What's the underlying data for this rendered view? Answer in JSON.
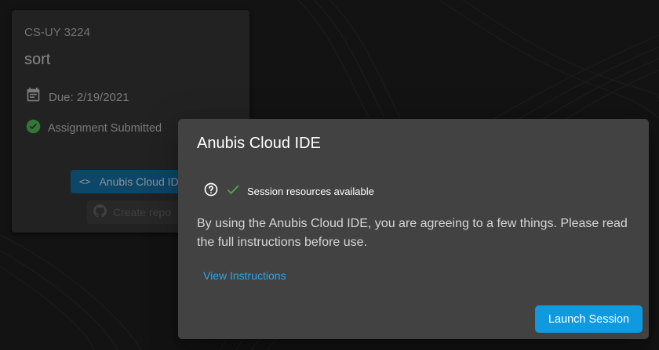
{
  "card": {
    "course": "CS-UY 3224",
    "name": "sort",
    "due": "Due: 2/19/2021",
    "status": "Assignment Submitted",
    "ide_button": "Anubis Cloud IDE",
    "ide_button_icon": "code-icon",
    "repo_button": "Create repo",
    "repo_button_icon": "github-icon"
  },
  "dialog": {
    "title": "Anubis Cloud IDE",
    "status_text": "Session resources available",
    "body": "By using the Anubis Cloud IDE, you are agreeing to a few things. Please read the full instructions before use.",
    "link": "View Instructions",
    "launch_button": "Launch Session"
  },
  "colors": {
    "accent": "#0f9ae0",
    "link": "#2aa6e6",
    "success": "#4caf50",
    "dialog_bg": "#424242",
    "card_bg": "#333333"
  }
}
